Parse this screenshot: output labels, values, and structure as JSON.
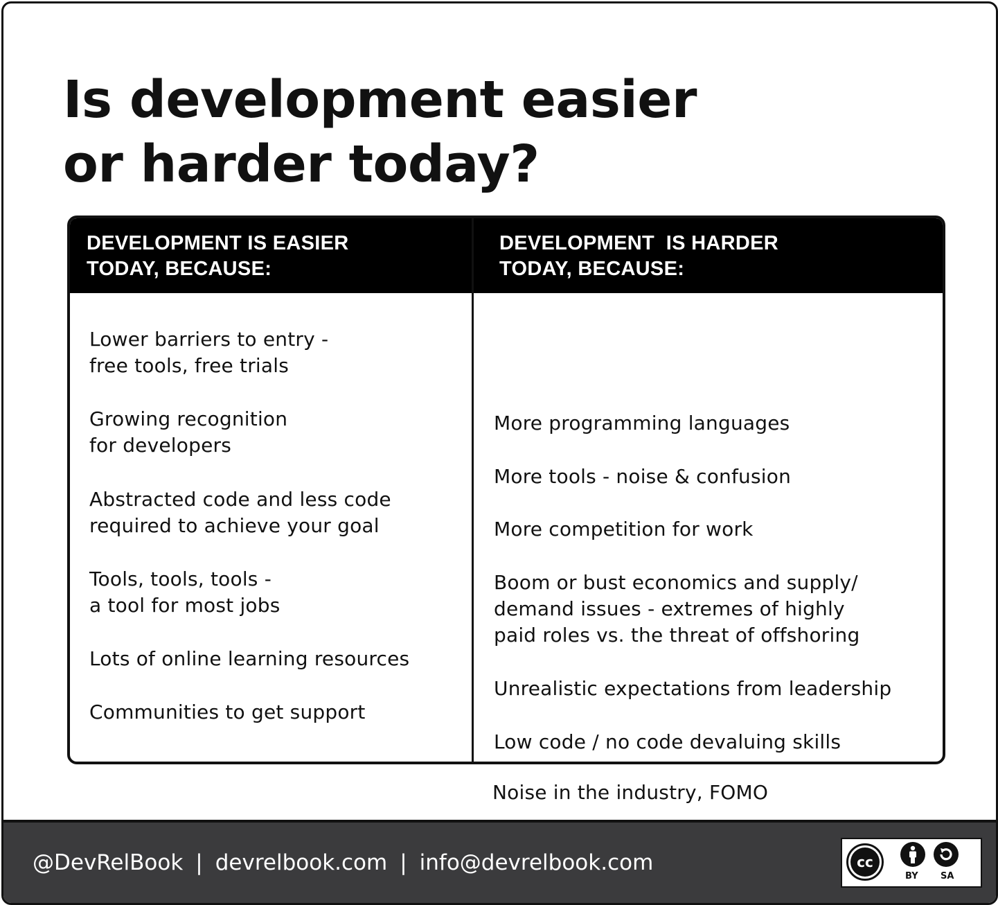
{
  "title": "Is development easier\nor harder today?",
  "table": {
    "left_heading": "DEVELOPMENT IS EASIER\nTODAY, BECAUSE:",
    "right_heading": "DEVELOPMENT  IS HARDER\nTODAY, BECAUSE:",
    "easier_items": [
      "Lower barriers to entry -\nfree tools, free trials",
      "Growing recognition\nfor developers",
      "Abstracted code and less code\nrequired to achieve your goal",
      "Tools, tools, tools -\na tool for most jobs",
      "Lots of online learning resources",
      "Communities to get support"
    ],
    "harder_items": [
      "More programming languages",
      "More tools - noise & confusion",
      "More competition for work",
      "Boom or bust economics and supply/\ndemand issues - extremes of highly\npaid roles vs. the threat of offshoring",
      "Unrealistic expectations from leadership",
      "Low code / no code devaluing skills",
      "Noise in the industry, FOMO"
    ]
  },
  "footer": {
    "handle": "@DevRelBook",
    "website": "devrelbook.com",
    "email": "info@devrelbook.com",
    "separator": "|",
    "license_logo": {
      "icons": [
        "cc-icon",
        "by-icon",
        "sa-icon"
      ],
      "cc_text": "cc",
      "by_label": "BY",
      "sa_label": "SA"
    }
  },
  "colors": {
    "header_bar": "#000000",
    "footer_bar": "#3b3b3d",
    "text": "#111111",
    "background": "#ffffff"
  }
}
